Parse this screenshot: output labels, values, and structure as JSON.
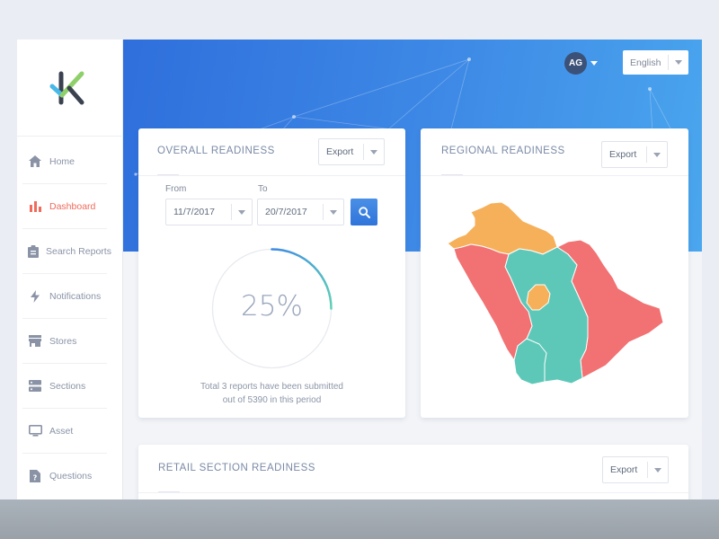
{
  "sidebar": {
    "items": [
      {
        "label": "Home",
        "icon": "home-icon"
      },
      {
        "label": "Dashboard",
        "icon": "bar-chart-icon",
        "active": true
      },
      {
        "label": "Search Reports",
        "icon": "clipboard-icon"
      },
      {
        "label": "Notifications",
        "icon": "lightning-icon"
      },
      {
        "label": "Stores",
        "icon": "store-icon"
      },
      {
        "label": "Sections",
        "icon": "sections-icon"
      },
      {
        "label": "Asset",
        "icon": "monitor-icon"
      },
      {
        "label": "Questions",
        "icon": "question-doc-icon"
      }
    ]
  },
  "header": {
    "avatar_initials": "AG",
    "language": "English"
  },
  "overall": {
    "title": "OVERALL READINESS",
    "export_label": "Export",
    "from_label": "From",
    "to_label": "To",
    "from_value": "11/7/2017",
    "to_value": "20/7/2017",
    "progress_text": "25%",
    "progress_value": 0.25,
    "summary_line1": "Total 3 reports have been submitted",
    "summary_line2": "out of 5390 in this period"
  },
  "regional": {
    "title": "REGIONAL READINESS",
    "export_label": "Export"
  },
  "retail": {
    "title": "RETAIL SECTION READINESS",
    "export_label": "Export"
  },
  "colors": {
    "accent_blue": "#2f74da",
    "active_nav": "#ef6b5c",
    "map_red": "#f27172",
    "map_orange": "#f6b05a",
    "map_teal": "#5ec8b8",
    "gauge_start": "#3f8be4",
    "gauge_end": "#5fd1b4"
  }
}
